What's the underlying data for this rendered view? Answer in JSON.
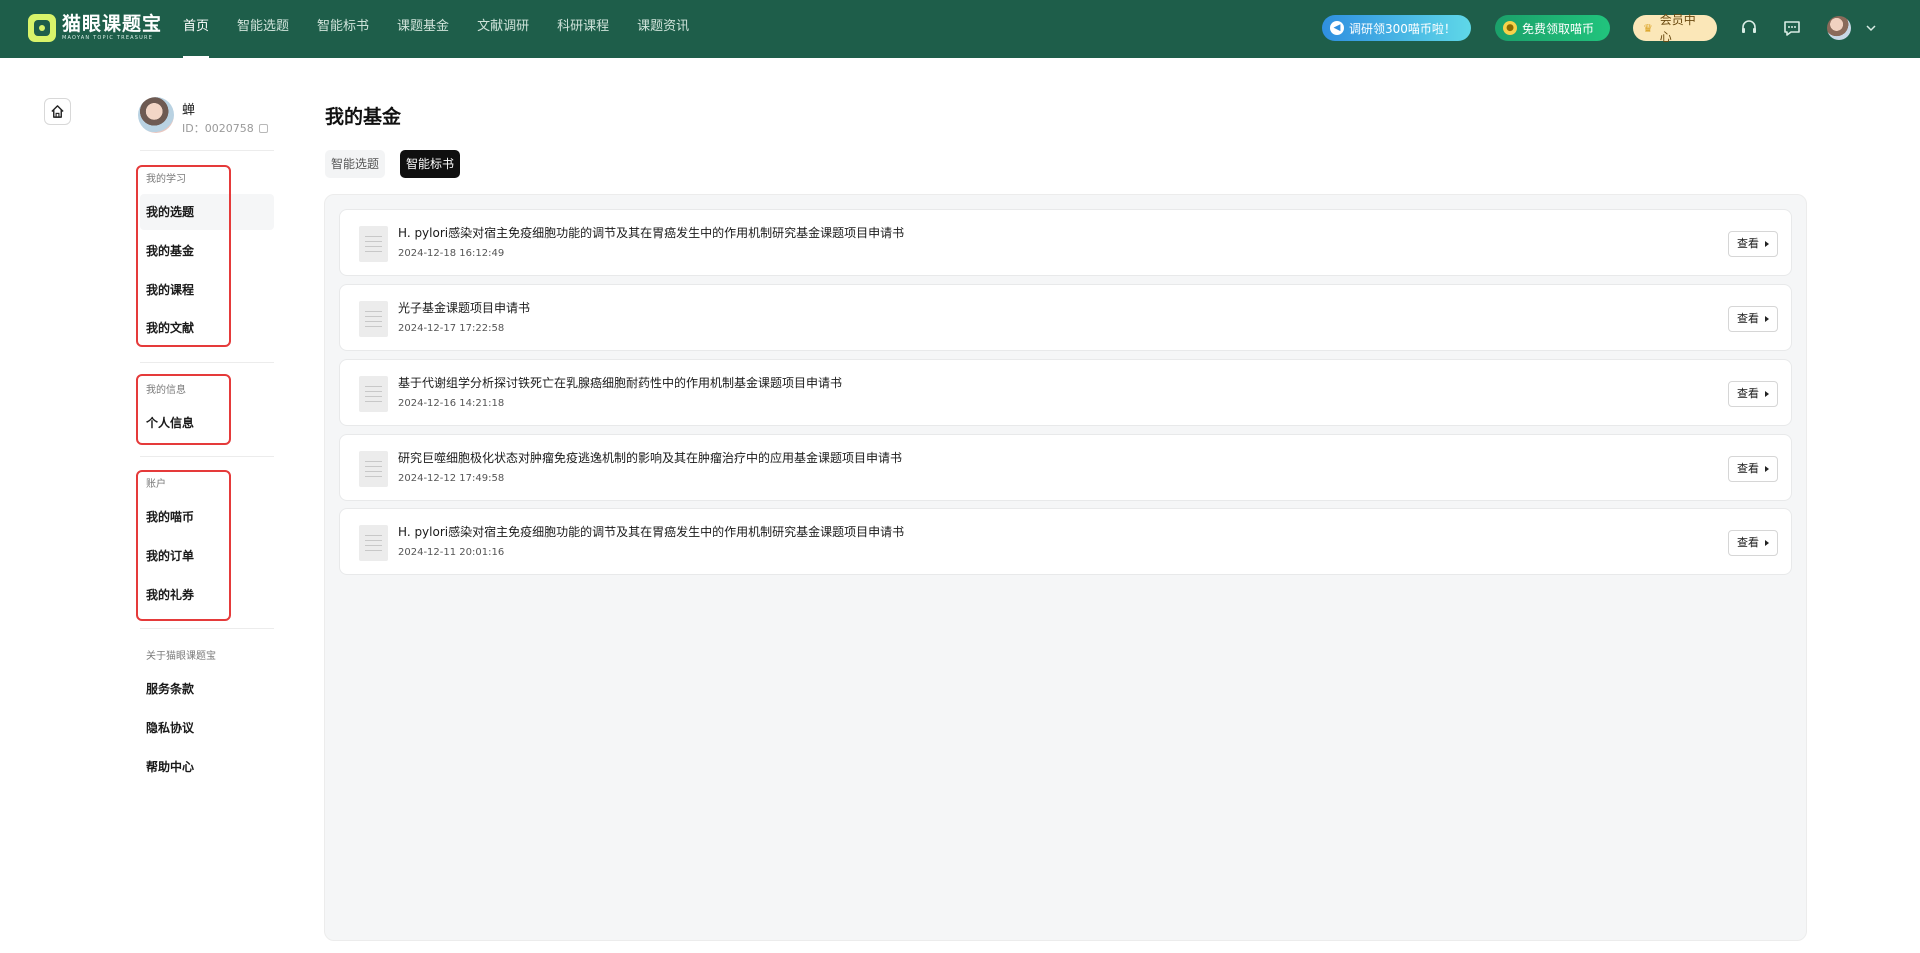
{
  "brand": {
    "name": "猫眼课题宝",
    "tagline": "MAOYAN TOPIC TREASURE"
  },
  "nav": {
    "items": [
      "首页",
      "智能选题",
      "智能标书",
      "课题基金",
      "文献调研",
      "科研课程",
      "课题资讯"
    ],
    "active_index": 0
  },
  "promos": {
    "survey": "调研领300喵币啦！",
    "free_coins": "免费领取喵币",
    "member": "会员中心"
  },
  "profile": {
    "name": "蝉",
    "id_text": "ID：0020758"
  },
  "sidebar": {
    "learning_label": "我的学习",
    "learning": [
      "我的选题",
      "我的基金",
      "我的课程",
      "我的文献"
    ],
    "info_label": "我的信息",
    "info": [
      "个人信息"
    ],
    "account_label": "账户",
    "account": [
      "我的喵币",
      "我的订单",
      "我的礼券"
    ],
    "about_label": "关于猫眼课题宝",
    "about": [
      "服务条款",
      "隐私协议",
      "帮助中心"
    ]
  },
  "main": {
    "title": "我的基金",
    "tabs": [
      "智能选题",
      "智能标书"
    ],
    "active_tab": 1,
    "view_label": "查看",
    "records": [
      {
        "title": "H. pylori感染对宿主免疫细胞功能的调节及其在胃癌发生中的作用机制研究基金课题项目申请书",
        "date": "2024-12-18 16:12:49"
      },
      {
        "title": "光子基金课题项目申请书",
        "date": "2024-12-17 17:22:58"
      },
      {
        "title": "基于代谢组学分析探讨铁死亡在乳腺癌细胞耐药性中的作用机制基金课题项目申请书",
        "date": "2024-12-16 14:21:18"
      },
      {
        "title": "研究巨噬细胞极化状态对肿瘤免疫逃逸机制的影响及其在肿瘤治疗中的应用基金课题项目申请书",
        "date": "2024-12-12 17:49:58"
      },
      {
        "title": "H. pylori感染对宿主免疫细胞功能的调节及其在胃癌发生中的作用机制研究基金课题项目申请书",
        "date": "2024-12-11 20:01:16"
      }
    ]
  },
  "colors": {
    "topbar": "#1e5e4a",
    "highlight_box": "#e53a3a",
    "active_tab": "#0f0f0f"
  }
}
